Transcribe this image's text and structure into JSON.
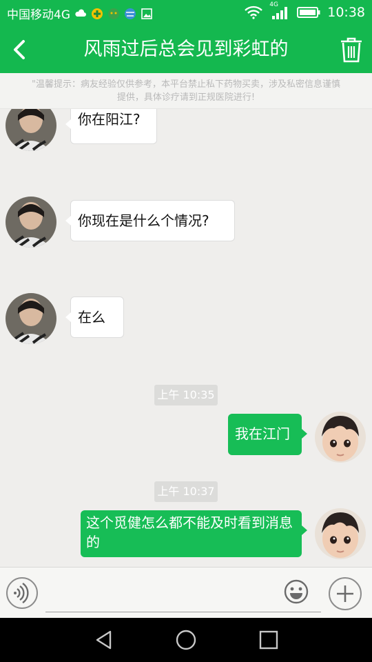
{
  "status_bar": {
    "carrier": "中国移动4G",
    "network": "4G",
    "time": "10:38",
    "icons": [
      "cloud-icon",
      "app-badge-icon",
      "app-face-icon",
      "globe-icon",
      "image-icon",
      "wifi-icon",
      "signal-icon",
      "battery-icon"
    ]
  },
  "header": {
    "title": "风雨过后总会见到彩虹的",
    "back_icon": "chevron-left-icon",
    "delete_icon": "trash-icon"
  },
  "notice": {
    "line1": "\"温馨提示：病友经验仅供参考，本平台禁止私下药物买卖，涉及私密信息谨慎",
    "line2": "提供，具体诊疗请到正规医院进行!"
  },
  "messages": [
    {
      "side": "in",
      "text": "你在阳江?"
    },
    {
      "side": "in",
      "text": "你现在是什么个情况?"
    },
    {
      "side": "in",
      "text": "在么"
    },
    {
      "type": "time",
      "text": "上午 10:35"
    },
    {
      "side": "out",
      "text": "我在江门"
    },
    {
      "type": "time",
      "text": "上午 10:37"
    },
    {
      "side": "out",
      "text": "这个觅健怎么都不能及时看到消息的"
    }
  ],
  "input_bar": {
    "placeholder": "",
    "value": "",
    "voice_icon": "voice-icon",
    "emoji_icon": "emoji-icon",
    "plus_icon": "plus-icon"
  },
  "nav_bar": {
    "icons": [
      "back-triangle-icon",
      "home-circle-icon",
      "recents-square-icon"
    ]
  },
  "colors": {
    "brand_green": "#14b84f",
    "out_bubble": "#17bd56",
    "chat_bg": "#efeeec"
  }
}
